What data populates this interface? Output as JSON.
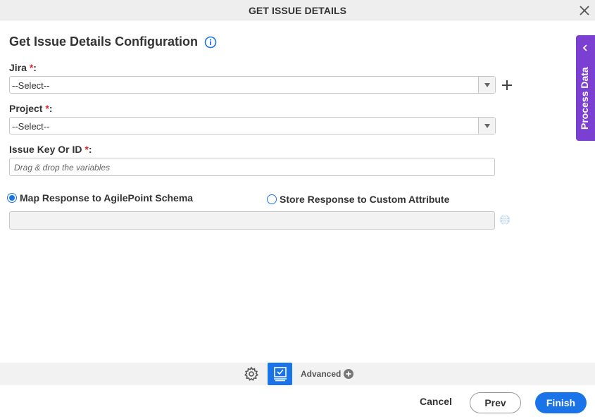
{
  "window": {
    "title": "GET ISSUE DETAILS"
  },
  "form": {
    "heading": "Get Issue Details Configuration",
    "jira": {
      "label": "Jira",
      "required_mark": "*",
      "suffix": ":",
      "value": "--Select--"
    },
    "project": {
      "label": "Project",
      "required_mark": "*",
      "suffix": ":",
      "value": "--Select--"
    },
    "issue_key": {
      "label": "Issue Key Or ID",
      "required_mark": "*",
      "suffix": ":",
      "placeholder": "Drag & drop the variables"
    },
    "response": {
      "map_label": "Map Response to AgilePoint Schema",
      "store_label": "Store Response to Custom Attribute",
      "selected": "map",
      "schema_value": ""
    }
  },
  "side_panel": {
    "label": "Process Data"
  },
  "toolbar": {
    "advanced_label": "Advanced"
  },
  "footer": {
    "cancel_label": "Cancel",
    "prev_label": "Prev",
    "finish_label": "Finish"
  },
  "colors": {
    "accent": "#1a73e8",
    "side_panel": "#7b3fd1",
    "required": "#d9272e"
  }
}
